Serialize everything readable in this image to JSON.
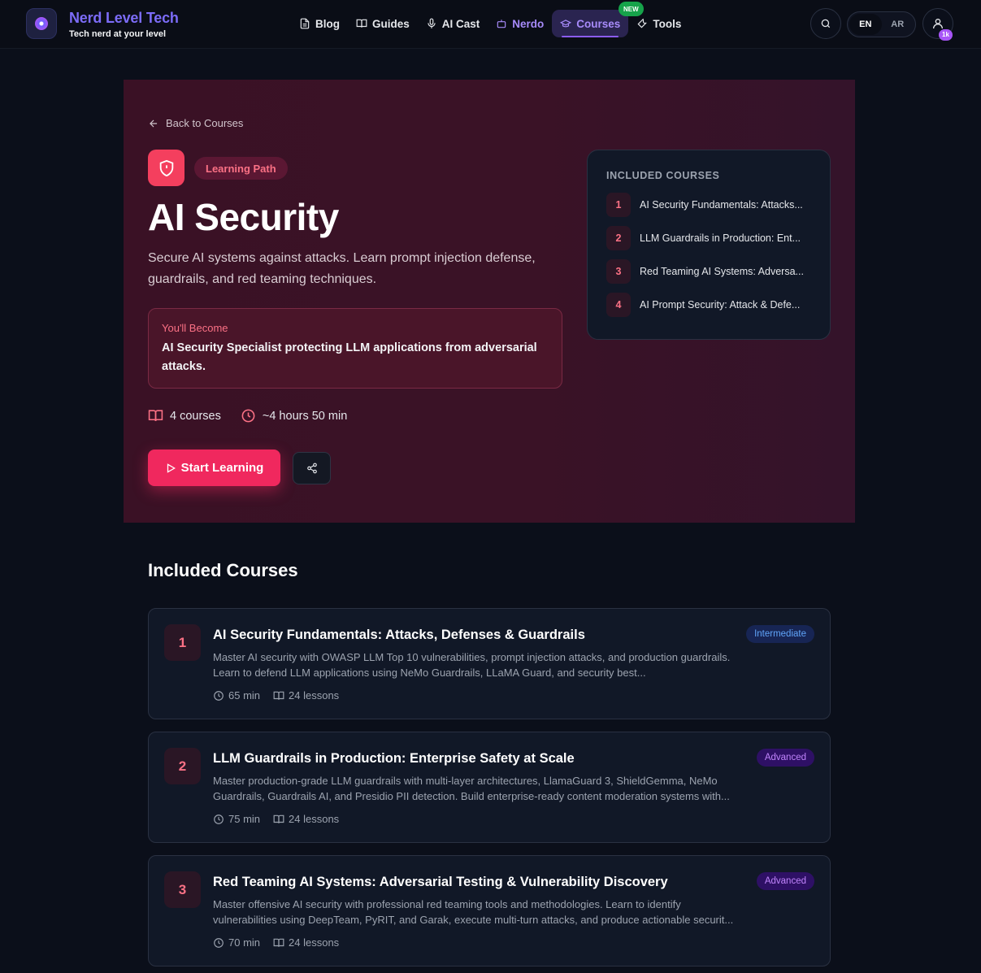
{
  "brand": {
    "title": "Nerd Level Tech",
    "subtitle": "Tech nerd at your level"
  },
  "nav": {
    "items": [
      {
        "label": "Blog",
        "icon": "document-icon"
      },
      {
        "label": "Guides",
        "icon": "book-icon"
      },
      {
        "label": "AI Cast",
        "icon": "microphone-icon"
      },
      {
        "label": "Nerdo",
        "icon": "robot-icon"
      },
      {
        "label": "Courses",
        "icon": "graduation-cap-icon"
      },
      {
        "label": "Tools",
        "icon": "wrench-icon"
      }
    ],
    "new_badge": "NEW",
    "lang_en": "EN",
    "lang_ar": "AR",
    "user_badge": "1k"
  },
  "hero": {
    "back_label": "Back to Courses",
    "badge": "Learning Path",
    "title": "AI Security",
    "description": "Secure AI systems against attacks. Learn prompt injection defense, guardrails, and red teaming techniques.",
    "become_label": "You'll Become",
    "become_text": "AI Security Specialist protecting LLM applications from adversarial attacks.",
    "courses_count": "4 courses",
    "duration": "~4 hours 50 min",
    "start_label": "Start Learning",
    "colors": {
      "accent": "#f0285e",
      "background": "#3a1125"
    }
  },
  "included_card": {
    "title": "INCLUDED COURSES",
    "items": [
      {
        "num": "1",
        "name": "AI Security Fundamentals: Attacks..."
      },
      {
        "num": "2",
        "name": "LLM Guardrails in Production: Ent..."
      },
      {
        "num": "3",
        "name": "Red Teaming AI Systems: Adversa..."
      },
      {
        "num": "4",
        "name": "AI Prompt Security: Attack & Defe..."
      }
    ]
  },
  "courses_section": {
    "title": "Included Courses",
    "courses": [
      {
        "num": "1",
        "title": "AI Security Fundamentals: Attacks, Defenses & Guardrails",
        "desc": "Master AI security with OWASP LLM Top 10 vulnerabilities, prompt injection attacks, and production guardrails. Learn to defend LLM applications using NeMo Guardrails, LLaMA Guard, and security best...",
        "duration": "65 min",
        "lessons": "24 lessons",
        "level": "Intermediate"
      },
      {
        "num": "2",
        "title": "LLM Guardrails in Production: Enterprise Safety at Scale",
        "desc": "Master production-grade LLM guardrails with multi-layer architectures, LlamaGuard 3, ShieldGemma, NeMo Guardrails, Guardrails AI, and Presidio PII detection. Build enterprise-ready content moderation systems with...",
        "duration": "75 min",
        "lessons": "24 lessons",
        "level": "Advanced"
      },
      {
        "num": "3",
        "title": "Red Teaming AI Systems: Adversarial Testing & Vulnerability Discovery",
        "desc": "Master offensive AI security with professional red teaming tools and methodologies. Learn to identify vulnerabilities using DeepTeam, PyRIT, and Garak, execute multi-turn attacks, and produce actionable securit...",
        "duration": "70 min",
        "lessons": "24 lessons",
        "level": "Advanced"
      }
    ]
  }
}
